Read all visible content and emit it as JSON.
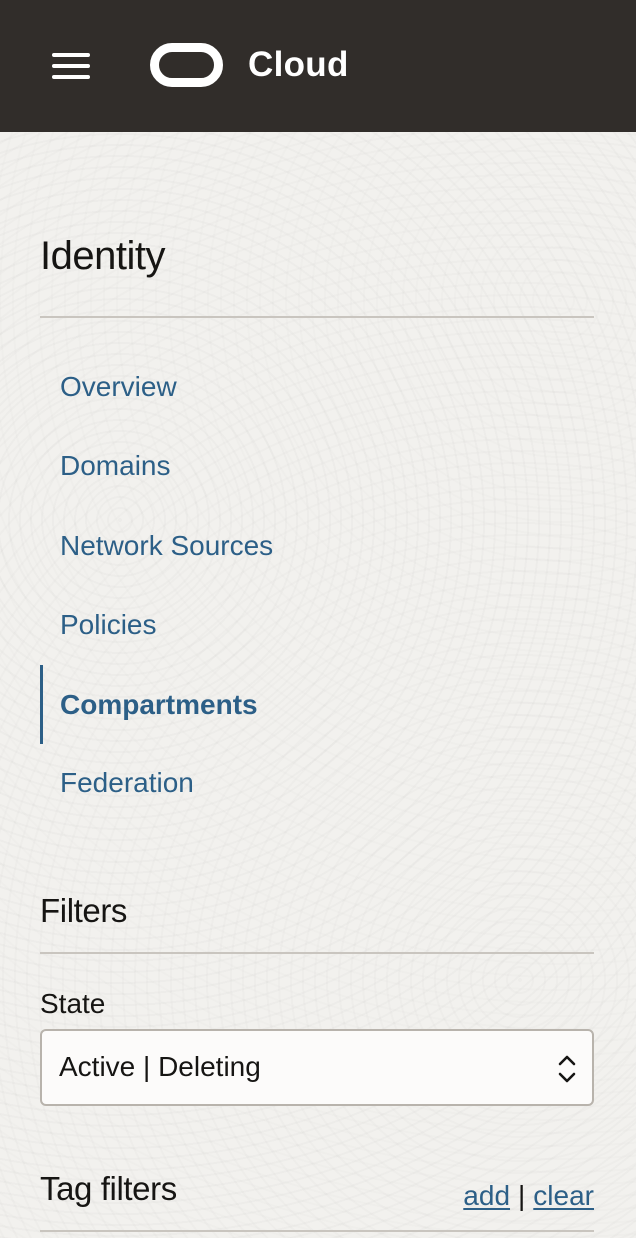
{
  "header": {
    "brand": "Cloud",
    "menu_icon": "hamburger-menu-icon",
    "logo_icon": "oracle-logo-icon",
    "background_color": "#312d2a"
  },
  "sidebar": {
    "title": "Identity",
    "items": [
      {
        "label": "Overview",
        "active": false
      },
      {
        "label": "Domains",
        "active": false
      },
      {
        "label": "Network Sources",
        "active": false
      },
      {
        "label": "Policies",
        "active": false
      },
      {
        "label": "Compartments",
        "active": true
      },
      {
        "label": "Federation",
        "active": false
      }
    ],
    "link_color": "#2c5f87"
  },
  "filters": {
    "title": "Filters",
    "state": {
      "label": "State",
      "value": "Active | Deleting",
      "icon": "select-chevrons-icon"
    }
  },
  "tag_filters": {
    "title": "Tag filters",
    "add_label": "add",
    "separator": "|",
    "clear_label": "clear"
  }
}
